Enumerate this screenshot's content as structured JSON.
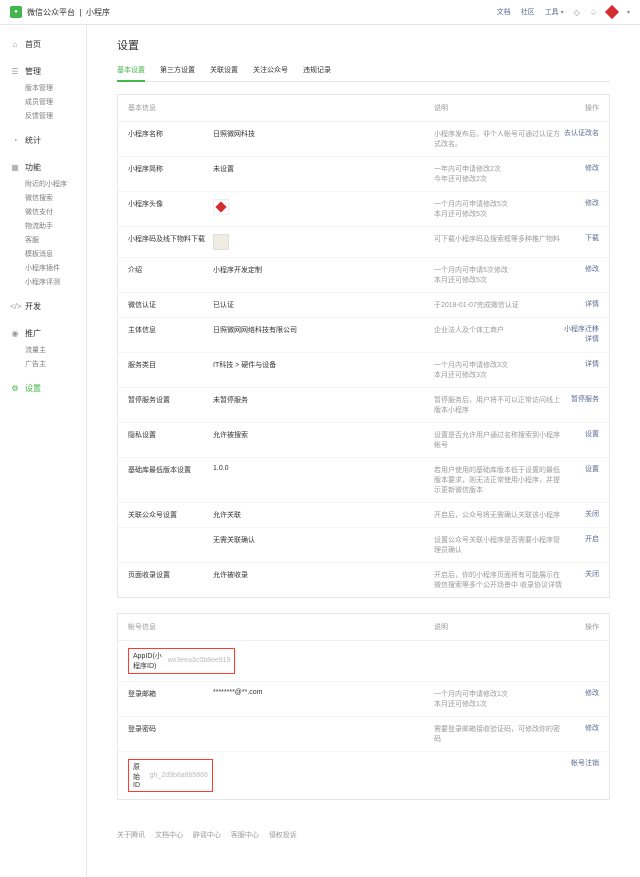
{
  "header": {
    "platform": "微信公众平台",
    "section": "小程序",
    "links": {
      "docs": "文档",
      "community": "社区",
      "tools": "工具"
    }
  },
  "sidebar": {
    "home": "首页",
    "manage": {
      "title": "管理",
      "items": [
        "版本管理",
        "成员管理",
        "反馈管理"
      ]
    },
    "stats": "统计",
    "features": {
      "title": "功能",
      "items": [
        "附近的小程序",
        "微信搜索",
        "微信支付",
        "物流助手",
        "客服",
        "模板消息",
        "小程序插件",
        "小程序评测"
      ]
    },
    "dev": "开发",
    "promo": {
      "title": "推广",
      "items": [
        "流量主",
        "广告主"
      ]
    },
    "settings": "设置"
  },
  "page": {
    "title": "设置",
    "tabs": [
      "基本设置",
      "第三方设置",
      "关联设置",
      "关注公众号",
      "违规记录"
    ]
  },
  "card1": {
    "head": {
      "c1": "基本信息",
      "c2": "",
      "c3": "说明",
      "c4": "操作"
    },
    "rows": [
      {
        "lbl": "小程序名称",
        "val": "日照微网科技",
        "desc": "小程序发布后，非个人帐号可通过认证方式改名。",
        "act": "去认证改名"
      },
      {
        "lbl": "小程序简称",
        "val": "未设置",
        "desc": "一年内可申请修改2次\n今年还可修改2次",
        "act": "修改"
      },
      {
        "lbl": "小程序头像",
        "val": "",
        "desc": "一个月内可申请修改5次\n本月还可修改5次",
        "act": "修改",
        "icon": "avatar"
      },
      {
        "lbl": "小程序码及线下物料下载",
        "val": "",
        "desc": "可下载小程序码及搜索框等多种推广物料",
        "act": "下载",
        "icon": "qr"
      },
      {
        "lbl": "介绍",
        "val": "小程序开发定制",
        "desc": "一个月内可申请5次修改\n本月还可修改5次",
        "act": "修改"
      },
      {
        "lbl": "微信认证",
        "val": "已认证",
        "desc": "于2018-01-07完成微信认证",
        "act": "详情"
      },
      {
        "lbl": "主体信息",
        "val": "日照微网网络科技有限公司",
        "desc": "企业法人及个体工商户",
        "act": "小程序迁移",
        "act2": "详情"
      },
      {
        "lbl": "服务类目",
        "val": "IT科技 > 硬件与设备",
        "desc": "一个月内可申请修改3次\n本月还可修改3次",
        "act": "详情"
      },
      {
        "lbl": "暂停服务设置",
        "val": "未暂停服务",
        "desc": "暂停服务后，用户将不可以正常访问线上版本小程序",
        "act": "暂停服务"
      },
      {
        "lbl": "隐私设置",
        "val": "允许被搜索",
        "desc": "设置是否允许用户通过名称搜索到小程序帐号",
        "act": "设置"
      },
      {
        "lbl": "基础库最低版本设置",
        "val": "1.0.0",
        "desc": "若用户使用的基础库版本低于设置的最低版本要求，则无法正常使用小程序，并提示更新微信版本",
        "act": "设置"
      },
      {
        "lbl": "关联公众号设置",
        "val": "允许关联",
        "desc": "开启后，公众号将无需确认关联该小程序",
        "act": "关闭"
      },
      {
        "lbl": "",
        "val": "无需关联确认",
        "desc": "设置公众号关联小程序是否需要小程序管理员确认",
        "act": "开启"
      },
      {
        "lbl": "页面收录设置",
        "val": "允许被收录",
        "desc": "开启后，你的小程序页面将有可能展示在微信搜索等多个公开场景中 收录协议详情",
        "act": "关闭"
      }
    ]
  },
  "card2": {
    "head": {
      "c1": "帐号信息",
      "c2": "",
      "c3": "说明",
      "c4": "操作"
    },
    "rows": [
      {
        "lbl": "AppID(小程序ID)",
        "val": "wx3eea3c0b8ee919",
        "desc": "",
        "act": "",
        "highlight": true
      },
      {
        "lbl": "登录邮箱",
        "val": "********@**.com",
        "desc": "一个月内可申请修改1次\n本月还可修改1次",
        "act": "修改"
      },
      {
        "lbl": "登录密码",
        "val": "",
        "desc": "需要登录邮箱接收验证码，可修改你的密码",
        "act": "修改"
      },
      {
        "lbl": "原始ID",
        "val": "gh_2d9b8a8b5866",
        "desc": "",
        "act": "帐号注销",
        "highlight": true
      }
    ]
  },
  "footer": [
    "关于腾讯",
    "文档中心",
    "辟谣中心",
    "客服中心",
    "侵权投诉"
  ]
}
